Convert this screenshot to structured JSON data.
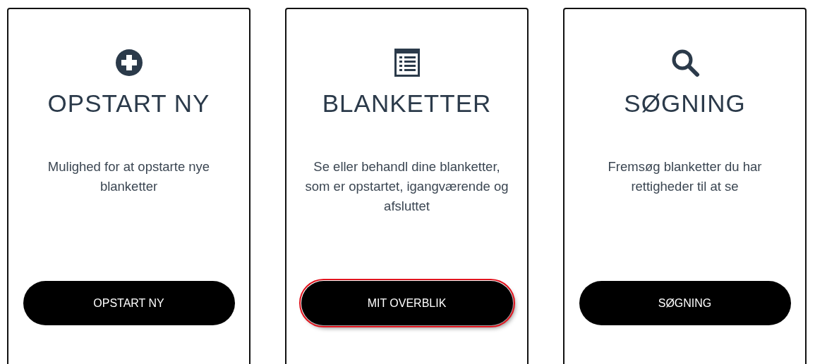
{
  "cards": [
    {
      "kind": "plus",
      "title": "OPSTART NY",
      "description": "Mulighed for at opstarte nye blanketter",
      "button": {
        "label": "OPSTART NY",
        "highlighted": false
      }
    },
    {
      "kind": "list",
      "title": "BLANKETTER",
      "description": "Se eller behandl dine blanketter, som er opstartet, igangværende og afsluttet",
      "button": {
        "label": "MIT OVERBLIK",
        "highlighted": true
      }
    },
    {
      "kind": "search",
      "title": "SØGNING",
      "description": "Fremsøg blanketter du har rettigheder til at se",
      "button": {
        "label": "SØGNING",
        "highlighted": false
      }
    }
  ]
}
